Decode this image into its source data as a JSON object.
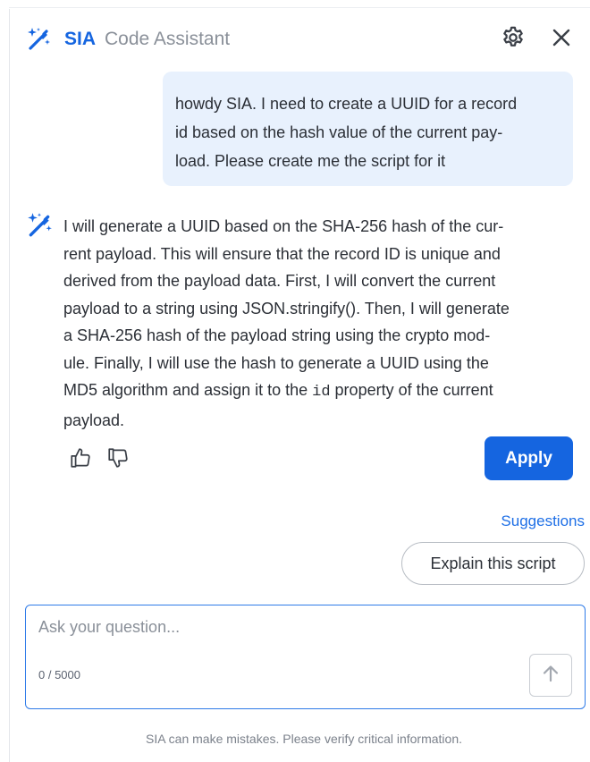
{
  "header": {
    "brand": "SIA",
    "subtitle": "Code Assistant"
  },
  "conversation": {
    "user_message": "howdy SIA. I need to create a UUID for a record id based on the hash value of the current pay-load. Please create me the script for it",
    "user_lines": [
      "howdy SIA. I need to create a UUID for a record",
      "id based on the hash value of the current pay-",
      "load. Please create me the script for it"
    ],
    "ai_lines": [
      "I will generate a UUID based on the SHA-256 hash of the cur-",
      "rent payload. This will ensure that the record ID is unique and",
      "derived from the payload data. First, I will convert the current",
      "payload to a string using JSON.stringify(). Then, I will generate",
      "a SHA-256 hash of the payload string using the crypto mod-",
      "ule. Finally, I will use the hash to generate a UUID using the",
      "MD5 algorithm and assign it to the ",
      "id",
      " property of the current",
      "payload."
    ]
  },
  "actions": {
    "apply_label": "Apply"
  },
  "suggestions": {
    "label": "Suggestions",
    "items": [
      "Explain this script"
    ]
  },
  "input": {
    "placeholder": "Ask your question...",
    "value": "",
    "counter": "0 / 5000"
  },
  "footer": {
    "disclaimer": "SIA can make mistakes. Please verify critical information."
  },
  "colors": {
    "accent": "#1565e0",
    "user_bubble": "#e8f1fd",
    "input_border": "#2f7be8"
  },
  "icons": {
    "brand": "sparkle-wand-icon",
    "settings": "gear-icon",
    "close": "close-icon",
    "thumbs_up": "thumbs-up-icon",
    "thumbs_down": "thumbs-down-icon",
    "send": "arrow-up-icon"
  }
}
